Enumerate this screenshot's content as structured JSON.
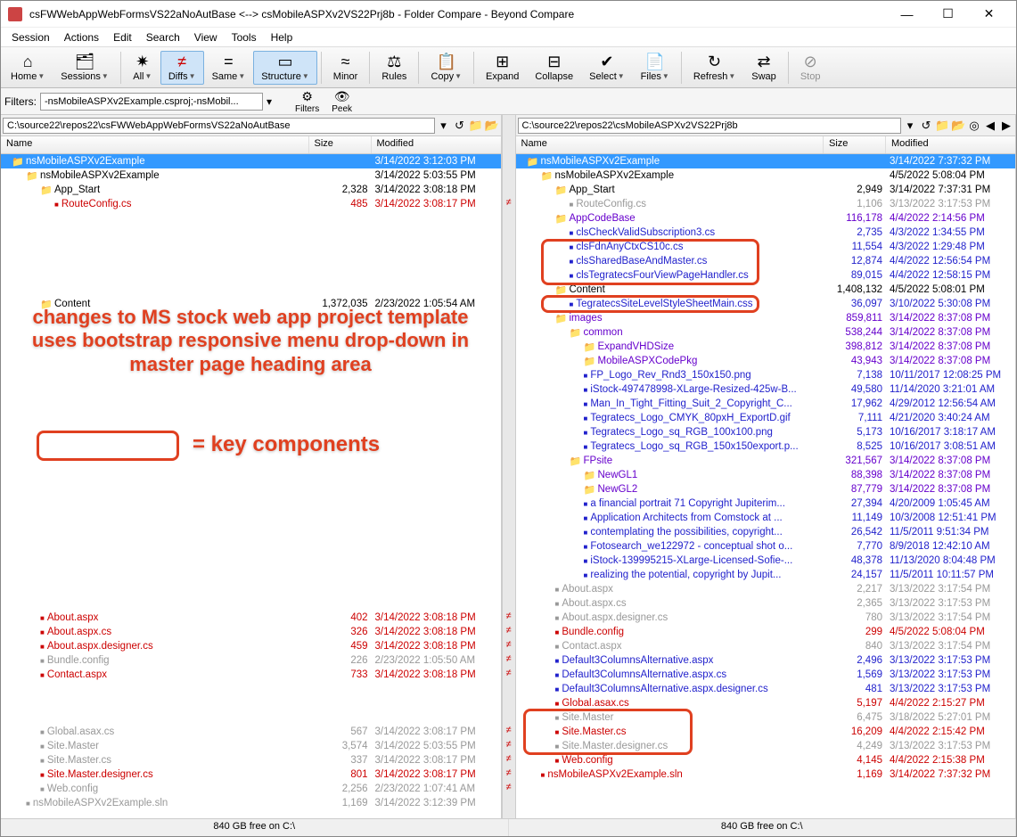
{
  "window": {
    "title": "csFWWebAppWebFormsVS22aNoAutBase <--> csMobileASPXv2VS22Prj8b - Folder Compare - Beyond Compare",
    "min": "—",
    "max": "☐",
    "close": "✕"
  },
  "menu": [
    "Session",
    "Actions",
    "Edit",
    "Search",
    "View",
    "Tools",
    "Help"
  ],
  "toolbar": [
    {
      "icon": "⌂",
      "label": "Home",
      "drop": true
    },
    {
      "icon": "🗂",
      "label": "Sessions",
      "drop": true
    },
    {
      "sep": true
    },
    {
      "icon": "✷",
      "label": "All",
      "drop": true
    },
    {
      "icon": "≠",
      "label": "Diffs",
      "drop": true,
      "active": true,
      "color": "#c00"
    },
    {
      "icon": "=",
      "label": "Same",
      "drop": true
    },
    {
      "icon": "▭",
      "label": "Structure",
      "drop": true,
      "active": true
    },
    {
      "sep": true
    },
    {
      "icon": "≈",
      "label": "Minor",
      "drop": false
    },
    {
      "sep": true
    },
    {
      "icon": "⚖",
      "label": "Rules",
      "drop": false
    },
    {
      "sep": true
    },
    {
      "icon": "📋",
      "label": "Copy",
      "drop": true
    },
    {
      "sep": true
    },
    {
      "icon": "⊞",
      "label": "Expand",
      "drop": false
    },
    {
      "icon": "⊟",
      "label": "Collapse",
      "drop": false
    },
    {
      "icon": "✔",
      "label": "Select",
      "drop": true
    },
    {
      "icon": "📄",
      "label": "Files",
      "drop": true
    },
    {
      "sep": true
    },
    {
      "icon": "↻",
      "label": "Refresh",
      "drop": true
    },
    {
      "icon": "⇄",
      "label": "Swap",
      "drop": false
    },
    {
      "sep": true
    },
    {
      "icon": "⊘",
      "label": "Stop",
      "drop": false,
      "disabled": true
    }
  ],
  "filters_label": "Filters:",
  "filters_value": "-nsMobileASPXv2Example.csproj;-nsMobil...",
  "filter_btns": [
    {
      "icon": "⚙",
      "label": "Filters"
    },
    {
      "icon": "👁",
      "label": "Peek"
    }
  ],
  "left_path": "C:\\source22\\repos22\\csFWWebAppWebFormsVS22aNoAutBase",
  "right_path": "C:\\source22\\repos22\\csMobileASPXv2VS22Prj8b",
  "cols": {
    "name": "Name",
    "size": "Size",
    "mod": "Modified"
  },
  "status_left": "840 GB free on C:\\",
  "status_right": "840 GB free on C:\\",
  "annotations": {
    "main_text": "changes to MS stock web app project template uses bootstrap responsive menu drop-down in master page heading area",
    "key_label": "= key components"
  },
  "left_rows": [
    {
      "i": 0,
      "t": "folder",
      "c": "selected",
      "n": "nsMobileASPXv2Example",
      "s": "",
      "m": "3/14/2022 3:12:03 PM",
      "fc": "folder-y"
    },
    {
      "i": 1,
      "t": "folder",
      "n": "nsMobileASPXv2Example",
      "s": "",
      "m": "3/14/2022 5:03:55 PM",
      "fc": "folder-y"
    },
    {
      "i": 2,
      "t": "folder",
      "n": "App_Start",
      "s": "2,328",
      "m": "3/14/2022 3:08:18 PM",
      "fc": "folder-y"
    },
    {
      "i": 3,
      "t": "file",
      "n": "RouteConfig.cs",
      "s": "485",
      "m": "3/14/2022 3:08:17 PM",
      "cls": "txt-red",
      "ne": true
    },
    {
      "i": 0,
      "blank": true
    },
    {
      "i": 0,
      "blank": true
    },
    {
      "i": 0,
      "blank": true
    },
    {
      "i": 0,
      "blank": true
    },
    {
      "i": 0,
      "blank": true
    },
    {
      "i": 0,
      "blank": true
    },
    {
      "i": 2,
      "t": "folder",
      "n": "Content",
      "s": "1,372,035",
      "m": "2/23/2022 1:05:54 AM",
      "fc": "folder-g"
    },
    {
      "i": 0,
      "blank": true
    },
    {
      "i": 0,
      "blank": true
    },
    {
      "i": 0,
      "blank": true
    },
    {
      "i": 0,
      "blank": true
    },
    {
      "i": 0,
      "blank": true
    },
    {
      "i": 0,
      "blank": true
    },
    {
      "i": 0,
      "blank": true
    },
    {
      "i": 0,
      "blank": true
    },
    {
      "i": 0,
      "blank": true
    },
    {
      "i": 0,
      "blank": true
    },
    {
      "i": 0,
      "blank": true
    },
    {
      "i": 0,
      "blank": true
    },
    {
      "i": 0,
      "blank": true
    },
    {
      "i": 0,
      "blank": true
    },
    {
      "i": 0,
      "blank": true
    },
    {
      "i": 0,
      "blank": true
    },
    {
      "i": 0,
      "blank": true
    },
    {
      "i": 0,
      "blank": true
    },
    {
      "i": 0,
      "blank": true
    },
    {
      "i": 0,
      "blank": true
    },
    {
      "i": 0,
      "blank": true
    },
    {
      "i": 2,
      "t": "file",
      "n": "About.aspx",
      "s": "402",
      "m": "3/14/2022 3:08:18 PM",
      "cls": "txt-red",
      "ne": true
    },
    {
      "i": 2,
      "t": "file",
      "n": "About.aspx.cs",
      "s": "326",
      "m": "3/14/2022 3:08:18 PM",
      "cls": "txt-red",
      "ne": true
    },
    {
      "i": 2,
      "t": "file",
      "n": "About.aspx.designer.cs",
      "s": "459",
      "m": "3/14/2022 3:08:18 PM",
      "cls": "txt-red",
      "ne": true
    },
    {
      "i": 2,
      "t": "file",
      "n": "Bundle.config",
      "s": "226",
      "m": "2/23/2022 1:05:50 AM",
      "ne": true,
      "cls": "txt-gray"
    },
    {
      "i": 2,
      "t": "file",
      "n": "Contact.aspx",
      "s": "733",
      "m": "3/14/2022 3:08:18 PM",
      "cls": "txt-red",
      "ne": true
    },
    {
      "i": 0,
      "blank": true
    },
    {
      "i": 0,
      "blank": true
    },
    {
      "i": 0,
      "blank": true
    },
    {
      "i": 2,
      "t": "file",
      "n": "Global.asax.cs",
      "s": "567",
      "m": "3/14/2022 3:08:17 PM",
      "ne": true,
      "cls": "txt-gray"
    },
    {
      "i": 2,
      "t": "file",
      "n": "Site.Master",
      "s": "3,574",
      "m": "3/14/2022 5:03:55 PM",
      "ne": true,
      "cls": "txt-gray"
    },
    {
      "i": 2,
      "t": "file",
      "n": "Site.Master.cs",
      "s": "337",
      "m": "3/14/2022 3:08:17 PM",
      "ne": true,
      "cls": "txt-gray"
    },
    {
      "i": 2,
      "t": "file",
      "n": "Site.Master.designer.cs",
      "s": "801",
      "m": "3/14/2022 3:08:17 PM",
      "cls": "txt-red",
      "ne": true
    },
    {
      "i": 2,
      "t": "file",
      "n": "Web.config",
      "s": "2,256",
      "m": "2/23/2022 1:07:41 AM",
      "ne": true,
      "cls": "txt-gray"
    },
    {
      "i": 1,
      "t": "file",
      "n": "nsMobileASPXv2Example.sln",
      "s": "1,169",
      "m": "3/14/2022 3:12:39 PM",
      "cls": "txt-gray"
    }
  ],
  "right_rows": [
    {
      "i": 0,
      "t": "folder",
      "c": "selected",
      "n": "nsMobileASPXv2Example",
      "s": "",
      "m": "3/14/2022 7:37:32 PM",
      "fc": "folder-y"
    },
    {
      "i": 1,
      "t": "folder",
      "n": "nsMobileASPXv2Example",
      "s": "",
      "m": "4/5/2022 5:08:04 PM",
      "fc": "folder-y"
    },
    {
      "i": 2,
      "t": "folder",
      "n": "App_Start",
      "s": "2,949",
      "m": "3/14/2022 7:37:31 PM",
      "fc": "folder-y"
    },
    {
      "i": 3,
      "t": "file",
      "n": "RouteConfig.cs",
      "s": "1,106",
      "m": "3/13/2022 3:17:53 PM",
      "cls": "txt-gray"
    },
    {
      "i": 2,
      "t": "folder",
      "n": "AppCodeBase",
      "s": "116,178",
      "m": "4/4/2022 2:14:56 PM",
      "fc": "folder-p",
      "cls": "txt-purple"
    },
    {
      "i": 3,
      "t": "file",
      "n": "clsCheckValidSubscription3.cs",
      "s": "2,735",
      "m": "4/3/2022 1:34:55 PM",
      "cls": "txt-blue"
    },
    {
      "i": 3,
      "t": "file",
      "n": "clsFdnAnyCtxCS10c.cs",
      "s": "11,554",
      "m": "4/3/2022 1:29:48 PM",
      "cls": "txt-blue"
    },
    {
      "i": 3,
      "t": "file",
      "n": "clsSharedBaseAndMaster.cs",
      "s": "12,874",
      "m": "4/4/2022 12:56:54 PM",
      "cls": "txt-blue"
    },
    {
      "i": 3,
      "t": "file",
      "n": "clsTegratecsFourViewPageHandler.cs",
      "s": "89,015",
      "m": "4/4/2022 12:58:15 PM",
      "cls": "txt-blue"
    },
    {
      "i": 2,
      "t": "folder",
      "n": "Content",
      "s": "1,408,132",
      "m": "4/5/2022 5:08:01 PM",
      "fc": "folder-y"
    },
    {
      "i": 3,
      "t": "file",
      "n": "TegratecsSiteLevelStyleSheetMain.css",
      "s": "36,097",
      "m": "3/10/2022 5:30:08 PM",
      "cls": "txt-blue"
    },
    {
      "i": 2,
      "t": "folder",
      "n": "images",
      "s": "859,811",
      "m": "3/14/2022 8:37:08 PM",
      "fc": "folder-p",
      "cls": "txt-purple"
    },
    {
      "i": 3,
      "t": "folder",
      "n": "common",
      "s": "538,244",
      "m": "3/14/2022 8:37:08 PM",
      "fc": "folder-p",
      "cls": "txt-purple"
    },
    {
      "i": 4,
      "t": "folder",
      "n": "ExpandVHDSize",
      "s": "398,812",
      "m": "3/14/2022 8:37:08 PM",
      "fc": "folder-p",
      "cls": "txt-purple"
    },
    {
      "i": 4,
      "t": "folder",
      "n": "MobileASPXCodePkg",
      "s": "43,943",
      "m": "3/14/2022 8:37:08 PM",
      "fc": "folder-p",
      "cls": "txt-purple"
    },
    {
      "i": 4,
      "t": "file",
      "n": "FP_Logo_Rev_Rnd3_150x150.png",
      "s": "7,138",
      "m": "10/11/2017 12:08:25 PM",
      "cls": "txt-blue"
    },
    {
      "i": 4,
      "t": "file",
      "n": "iStock-497478998-XLarge-Resized-425w-B...",
      "s": "49,580",
      "m": "11/14/2020 3:21:01 AM",
      "cls": "txt-blue"
    },
    {
      "i": 4,
      "t": "file",
      "n": "Man_In_Tight_Fitting_Suit_2_Copyright_C...",
      "s": "17,962",
      "m": "4/29/2012 12:56:54 AM",
      "cls": "txt-blue"
    },
    {
      "i": 4,
      "t": "file",
      "n": "Tegratecs_Logo_CMYK_80pxH_ExportD.gif",
      "s": "7,111",
      "m": "4/21/2020 3:40:24 AM",
      "cls": "txt-blue"
    },
    {
      "i": 4,
      "t": "file",
      "n": "Tegratecs_Logo_sq_RGB_100x100.png",
      "s": "5,173",
      "m": "10/16/2017 3:18:17 AM",
      "cls": "txt-blue"
    },
    {
      "i": 4,
      "t": "file",
      "n": "Tegratecs_Logo_sq_RGB_150x150export.p...",
      "s": "8,525",
      "m": "10/16/2017 3:08:51 AM",
      "cls": "txt-blue"
    },
    {
      "i": 3,
      "t": "folder",
      "n": "FPsite",
      "s": "321,567",
      "m": "3/14/2022 8:37:08 PM",
      "fc": "folder-p",
      "cls": "txt-purple"
    },
    {
      "i": 4,
      "t": "folder",
      "n": "NewGL1",
      "s": "88,398",
      "m": "3/14/2022 8:37:08 PM",
      "fc": "folder-p",
      "cls": "txt-purple"
    },
    {
      "i": 4,
      "t": "folder",
      "n": "NewGL2",
      "s": "87,779",
      "m": "3/14/2022 8:37:08 PM",
      "fc": "folder-p",
      "cls": "txt-purple"
    },
    {
      "i": 4,
      "t": "file",
      "n": "a financial portrait 71 Copyright Jupiterim...",
      "s": "27,394",
      "m": "4/20/2009 1:05:45 AM",
      "cls": "txt-blue"
    },
    {
      "i": 4,
      "t": "file",
      "n": "Application Architects from Comstock at ...",
      "s": "11,149",
      "m": "10/3/2008 12:51:41 PM",
      "cls": "txt-blue"
    },
    {
      "i": 4,
      "t": "file",
      "n": "contemplating the possibilities, copyright...",
      "s": "26,542",
      "m": "11/5/2011 9:51:34 PM",
      "cls": "txt-blue"
    },
    {
      "i": 4,
      "t": "file",
      "n": "Fotosearch_we122972 - conceptual shot o...",
      "s": "7,770",
      "m": "8/9/2018 12:42:10 AM",
      "cls": "txt-blue"
    },
    {
      "i": 4,
      "t": "file",
      "n": "iStock-139995215-XLarge-Licensed-Sofie-...",
      "s": "48,378",
      "m": "11/13/2020 8:04:48 PM",
      "cls": "txt-blue"
    },
    {
      "i": 4,
      "t": "file",
      "n": "realizing the potential, copyright by Jupit...",
      "s": "24,157",
      "m": "11/5/2011 10:11:57 PM",
      "cls": "txt-blue"
    },
    {
      "i": 2,
      "t": "file",
      "n": "About.aspx",
      "s": "2,217",
      "m": "3/13/2022 3:17:54 PM",
      "cls": "txt-gray"
    },
    {
      "i": 2,
      "t": "file",
      "n": "About.aspx.cs",
      "s": "2,365",
      "m": "3/13/2022 3:17:53 PM",
      "cls": "txt-gray"
    },
    {
      "i": 2,
      "t": "file",
      "n": "About.aspx.designer.cs",
      "s": "780",
      "m": "3/13/2022 3:17:54 PM",
      "cls": "txt-gray"
    },
    {
      "i": 2,
      "t": "file",
      "n": "Bundle.config",
      "s": "299",
      "m": "4/5/2022 5:08:04 PM",
      "cls": "txt-red"
    },
    {
      "i": 2,
      "t": "file",
      "n": "Contact.aspx",
      "s": "840",
      "m": "3/13/2022 3:17:54 PM",
      "cls": "txt-gray"
    },
    {
      "i": 2,
      "t": "file",
      "n": "Default3ColumnsAlternative.aspx",
      "s": "2,496",
      "m": "3/13/2022 3:17:53 PM",
      "cls": "txt-blue"
    },
    {
      "i": 2,
      "t": "file",
      "n": "Default3ColumnsAlternative.aspx.cs",
      "s": "1,569",
      "m": "3/13/2022 3:17:53 PM",
      "cls": "txt-blue"
    },
    {
      "i": 2,
      "t": "file",
      "n": "Default3ColumnsAlternative.aspx.designer.cs",
      "s": "481",
      "m": "3/13/2022 3:17:53 PM",
      "cls": "txt-blue"
    },
    {
      "i": 2,
      "t": "file",
      "n": "Global.asax.cs",
      "s": "5,197",
      "m": "4/4/2022 2:15:27 PM",
      "cls": "txt-red"
    },
    {
      "i": 2,
      "t": "file",
      "n": "Site.Master",
      "s": "6,475",
      "m": "3/18/2022 5:27:01 PM",
      "cls": "txt-gray"
    },
    {
      "i": 2,
      "t": "file",
      "n": "Site.Master.cs",
      "s": "16,209",
      "m": "4/4/2022 2:15:42 PM",
      "cls": "txt-red"
    },
    {
      "i": 2,
      "t": "file",
      "n": "Site.Master.designer.cs",
      "s": "4,249",
      "m": "3/13/2022 3:17:53 PM",
      "cls": "txt-gray"
    },
    {
      "i": 2,
      "t": "file",
      "n": "Web.config",
      "s": "4,145",
      "m": "4/4/2022 2:15:38 PM",
      "cls": "txt-red"
    },
    {
      "i": 1,
      "t": "file",
      "n": "nsMobileASPXv2Example.sln",
      "s": "1,169",
      "m": "3/14/2022 7:37:32 PM",
      "cls": "txt-red"
    }
  ]
}
